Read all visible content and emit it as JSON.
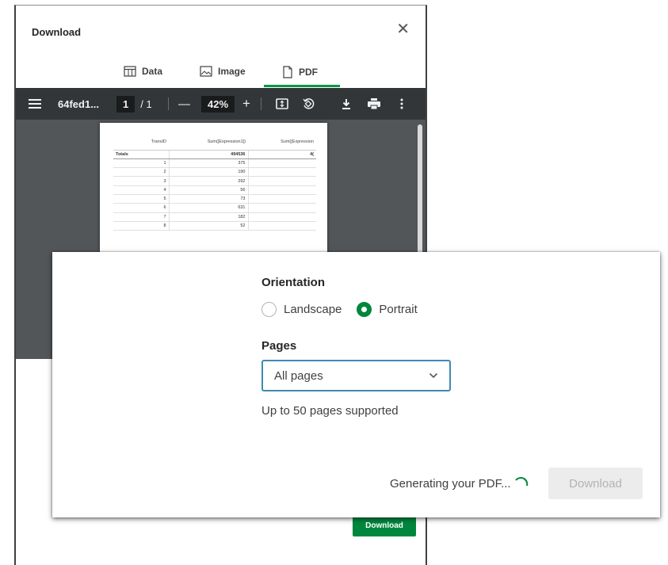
{
  "dialog": {
    "title": "Download",
    "close_icon": "close-icon",
    "tabs": [
      {
        "label": "Data",
        "icon": "table-icon"
      },
      {
        "label": "Image",
        "icon": "image-icon"
      },
      {
        "label": "PDF",
        "icon": "document-icon",
        "active": true
      }
    ],
    "download_label": "Download",
    "accent_color": "#009845"
  },
  "viewer": {
    "filename": "64fed1...",
    "page_current": "1",
    "page_total": "/ 1",
    "zoom_out": "—",
    "zoom": "42%",
    "zoom_in": "+",
    "icons": [
      "menu-icon",
      "fit-page-icon",
      "rotate-icon",
      "download-icon",
      "print-icon",
      "more-icon"
    ]
  },
  "pdf_table": {
    "headers": [
      "TransID",
      "Sum([Expression1])",
      "Sum([Expression"
    ],
    "totals": [
      "Totals",
      "494536",
      "4("
    ],
    "rows": [
      [
        "1",
        "375",
        ""
      ],
      [
        "2",
        "190",
        ""
      ],
      [
        "3",
        "292",
        ""
      ],
      [
        "4",
        "56",
        ""
      ],
      [
        "5",
        "73",
        ""
      ],
      [
        "6",
        "631",
        ""
      ],
      [
        "7",
        "182",
        ""
      ],
      [
        "8",
        "52",
        ""
      ]
    ]
  },
  "options": {
    "orientation_label": "Orientation",
    "orientation_options": [
      "Landscape",
      "Portrait"
    ],
    "orientation_selected": "Portrait",
    "pages_label": "Pages",
    "pages_value": "All pages",
    "pages_hint": "Up to 50 pages supported",
    "status": "Generating your PDF...",
    "download_label": "Download",
    "radio_color": "#00873d",
    "focus_color": "#3f8ab3"
  }
}
